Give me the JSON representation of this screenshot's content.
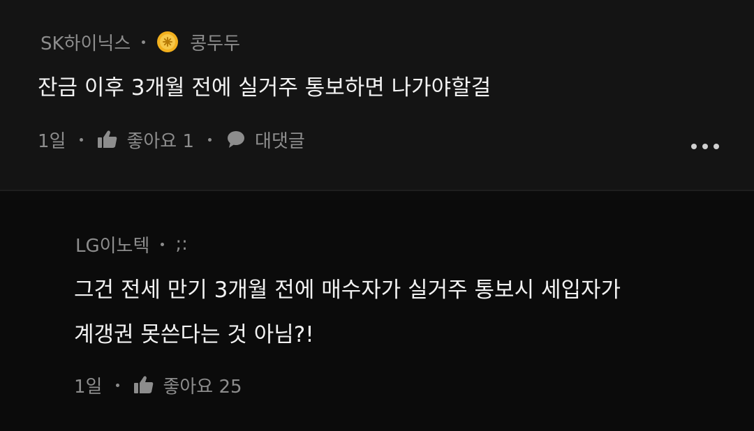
{
  "comments": [
    {
      "company": "SK하이닉스",
      "author": "콩두두",
      "body": "잔금 이후 3개월 전에 실거주 통보하면 나가야할걸",
      "time": "1일",
      "like_label": "좋아요 1",
      "reply_label": "대댓글",
      "badge_icon": "gold-badge-icon",
      "more_icon": "more-options-icon"
    }
  ],
  "reply": {
    "company": "LG이노텍",
    "author": ";:",
    "body_lines": [
      "그건 전세 만기 3개월 전에 매수자가 실거주 통보시 세입자가",
      "계갱권 못쓴다는 것 아님?!"
    ],
    "time": "1일",
    "like_label": "좋아요 25"
  },
  "colors": {
    "background": "#0b0b0b",
    "top_comment_background": "#141414",
    "text_primary": "#f2f2f2",
    "text_secondary": "#8d8d8d",
    "badge": "#f2b01e"
  }
}
